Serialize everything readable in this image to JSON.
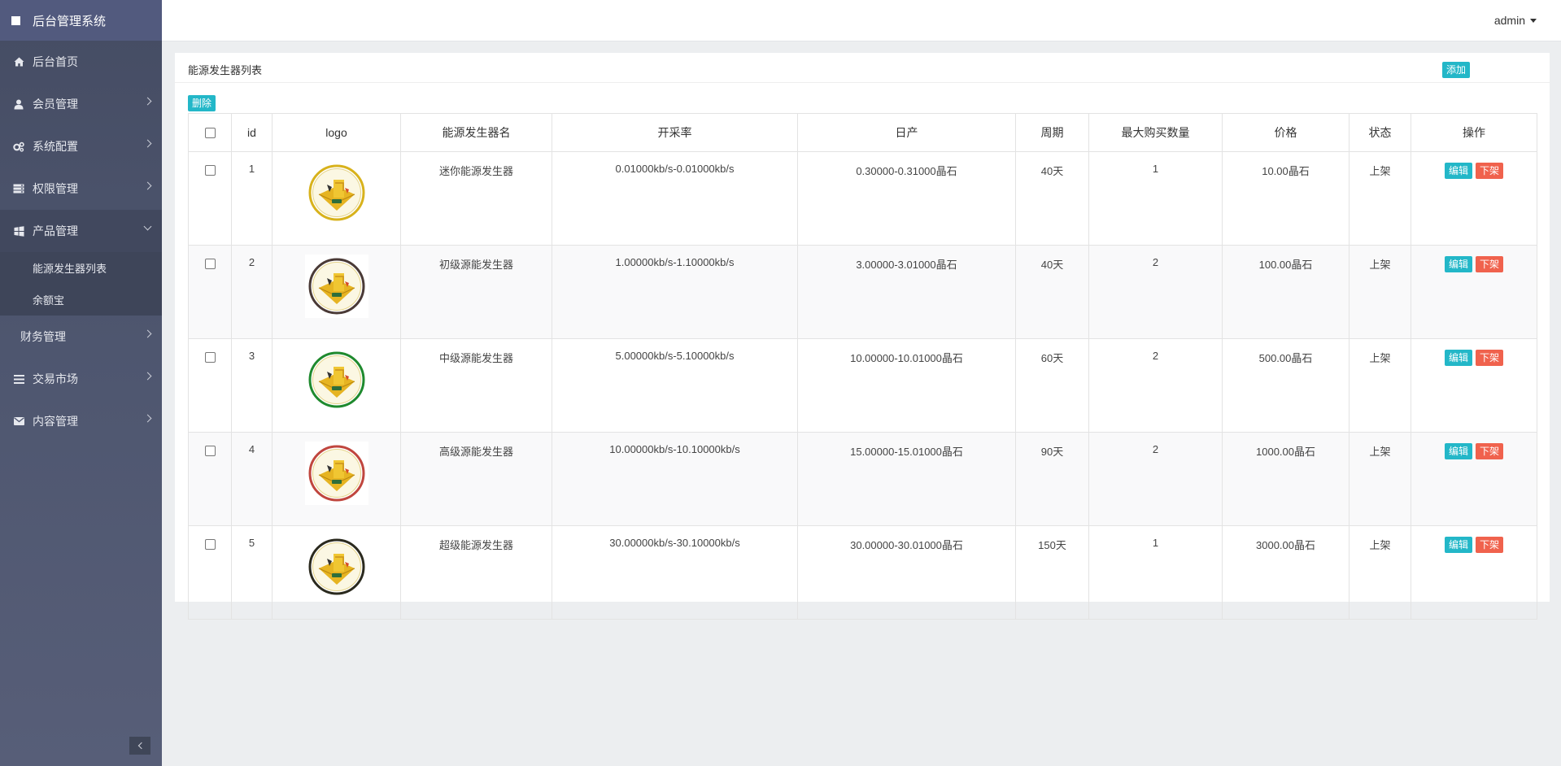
{
  "app": {
    "title": "后台管理系统"
  },
  "header": {
    "user": "admin"
  },
  "sidebar": {
    "items": [
      {
        "label": "后台首页",
        "icon": "home-icon",
        "has_arrow": false
      },
      {
        "label": "会员管理",
        "icon": "user-icon",
        "has_arrow": true
      },
      {
        "label": "系统配置",
        "icon": "gears-icon",
        "has_arrow": true
      },
      {
        "label": "权限管理",
        "icon": "server-icon",
        "has_arrow": true
      },
      {
        "label": "产品管理",
        "icon": "windows-icon",
        "has_arrow": true,
        "open": true,
        "children": [
          {
            "label": "能源发生器列表"
          },
          {
            "label": "余额宝"
          }
        ]
      },
      {
        "label": "财务管理",
        "icon": "",
        "has_arrow": true
      },
      {
        "label": "交易市场",
        "icon": "list-icon",
        "has_arrow": true
      },
      {
        "label": "内容管理",
        "icon": "envelope-icon",
        "has_arrow": true
      }
    ]
  },
  "panel": {
    "title": "能源发生器列表",
    "add_label": "添加",
    "delete_label": "删除",
    "columns": [
      "",
      "id",
      "logo",
      "能源发生器名",
      "开采率",
      "日产",
      "周期",
      "最大购买数量",
      "价格",
      "状态",
      "操作"
    ],
    "rows": [
      {
        "id": "1",
        "name": "迷你能源发生器",
        "rate": "0.01000kb/s-0.01000kb/s",
        "daily": "0.30000-0.31000晶石",
        "period": "40天",
        "max_buy": "1",
        "price": "10.00晶石",
        "status": "上架",
        "logo_ring": "#d8b21c"
      },
      {
        "id": "2",
        "name": "初级源能发生器",
        "rate": "1.00000kb/s-1.10000kb/s",
        "daily": "3.00000-3.01000晶石",
        "period": "40天",
        "max_buy": "2",
        "price": "100.00晶石",
        "status": "上架",
        "logo_ring": "#4a3a36"
      },
      {
        "id": "3",
        "name": "中级源能发生器",
        "rate": "5.00000kb/s-5.10000kb/s",
        "daily": "10.00000-10.01000晶石",
        "period": "60天",
        "max_buy": "2",
        "price": "500.00晶石",
        "status": "上架",
        "logo_ring": "#1f8a2e"
      },
      {
        "id": "4",
        "name": "高级源能发生器",
        "rate": "10.00000kb/s-10.10000kb/s",
        "daily": "15.00000-15.01000晶石",
        "period": "90天",
        "max_buy": "2",
        "price": "1000.00晶石",
        "status": "上架",
        "logo_ring": "#c0463e"
      },
      {
        "id": "5",
        "name": "超级能源发生器",
        "rate": "30.00000kb/s-30.10000kb/s",
        "daily": "30.00000-30.01000晶石",
        "period": "150天",
        "max_buy": "1",
        "price": "3000.00晶石",
        "status": "上架",
        "logo_ring": "#2b2a1e"
      }
    ],
    "edit_label": "编辑",
    "off_label": "下架"
  },
  "colors": {
    "accent": "#23b7c8",
    "danger": "#f0624d",
    "sidebar": "#4e566f"
  }
}
